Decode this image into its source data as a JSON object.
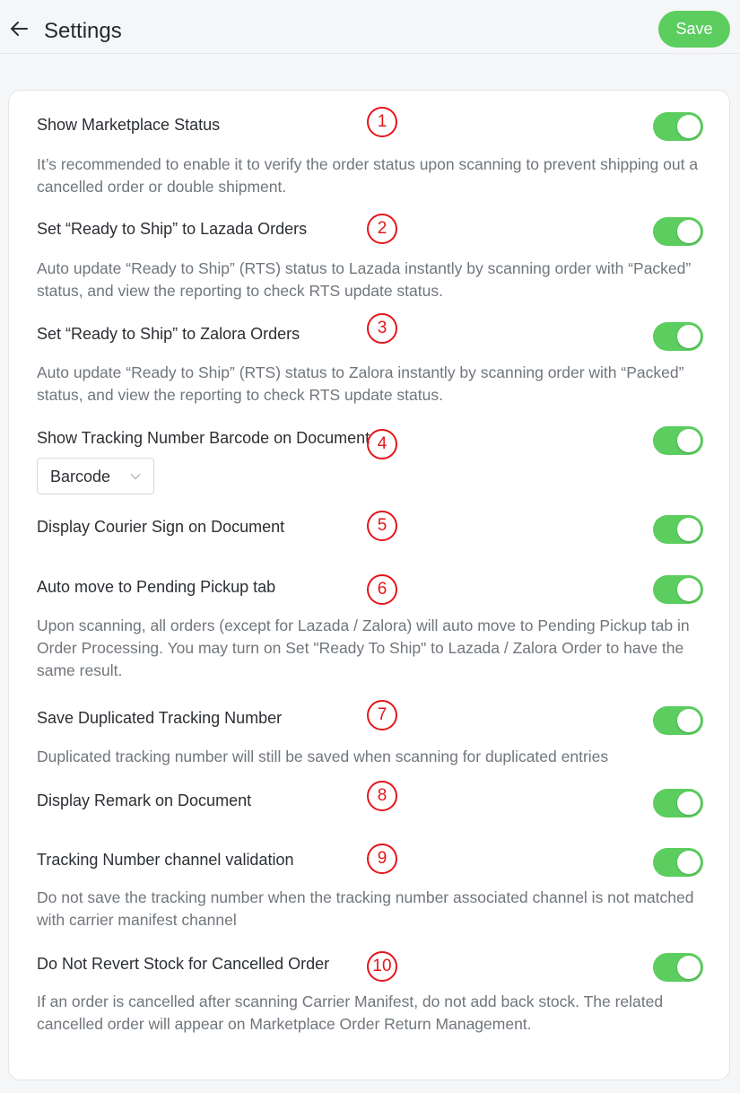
{
  "header": {
    "title": "Settings",
    "save_label": "Save"
  },
  "accent_color": "#5ccd5f",
  "marker_color": "#e4161b",
  "settings": [
    {
      "number": "1",
      "label": "Show Marketplace Status",
      "description": "It’s recommended to enable it to verify the order status upon scanning to prevent shipping out a cancelled order or double shipment.",
      "enabled": true
    },
    {
      "number": "2",
      "label": "Set “Ready to Ship” to Lazada Orders",
      "description": "Auto update “Ready to Ship” (RTS) status to Lazada instantly by scanning order with “Packed” status, and view the reporting to check RTS update status.",
      "enabled": true
    },
    {
      "number": "3",
      "label": "Set “Ready to Ship” to Zalora Orders",
      "description": "Auto update “Ready to Ship” (RTS) status to Zalora instantly by scanning order with “Packed” status, and view the reporting to check RTS update status.",
      "enabled": true
    },
    {
      "number": "4",
      "label": "Show Tracking Number Barcode on Document",
      "select_value": "Barcode",
      "enabled": true
    },
    {
      "number": "5",
      "label": "Display Courier Sign on Document",
      "enabled": true
    },
    {
      "number": "6",
      "label": "Auto move to Pending Pickup tab",
      "description": "Upon scanning, all orders (except for Lazada / Zalora) will auto move to Pending Pickup tab in Order Processing. You may turn on Set \"Ready To Ship\" to Lazada / Zalora Order to have the same result.",
      "enabled": true
    },
    {
      "number": "7",
      "label": "Save Duplicated Tracking Number",
      "description": "Duplicated tracking number will still be saved when scanning for duplicated entries",
      "enabled": true
    },
    {
      "number": "8",
      "label": "Display Remark on Document",
      "enabled": true
    },
    {
      "number": "9",
      "label": "Tracking Number channel validation",
      "description": "Do not save the tracking number when the tracking number associated channel is not matched with carrier manifest channel",
      "enabled": true
    },
    {
      "number": "10",
      "label": "Do Not Revert Stock for Cancelled Order",
      "description": "If an order is cancelled after scanning Carrier Manifest, do not add back stock. The related cancelled order will appear on Marketplace Order Return Management.",
      "enabled": true
    }
  ]
}
